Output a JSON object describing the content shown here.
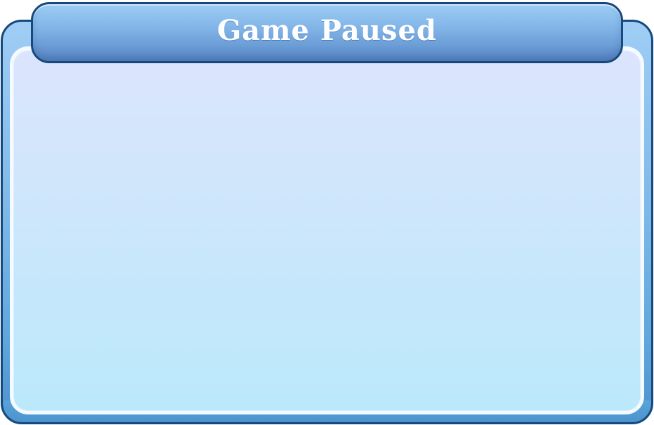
{
  "pause_dialog": {
    "title": "Game Paused"
  },
  "colors": {
    "frame_border": "#16497c",
    "frame_blue": "#7fb9e9",
    "inner_top": "#dbe5fd",
    "inner_bottom": "#bbe8fb",
    "title_text": "#ffffff"
  }
}
